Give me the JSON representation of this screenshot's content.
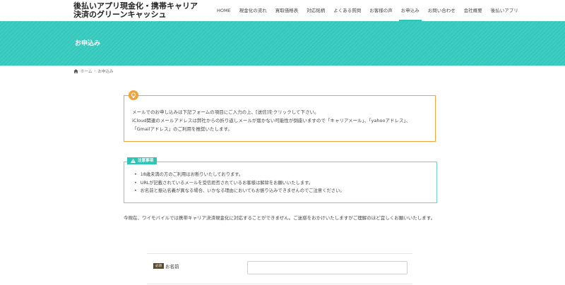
{
  "header": {
    "site_title_line1": "後払いアプリ現金化・携帯キャリア",
    "site_title_line2": "決済のグリーンキャッシュ",
    "nav": [
      {
        "label": "HOME"
      },
      {
        "label": "現金化の流れ"
      },
      {
        "label": "買取価格表"
      },
      {
        "label": "対応銘柄"
      },
      {
        "label": "よくある質問"
      },
      {
        "label": "お客様の声"
      },
      {
        "label": "お申込み",
        "active": true
      },
      {
        "label": "お問い合わせ"
      },
      {
        "label": "会社概要"
      },
      {
        "label": "後払いアプリ"
      }
    ]
  },
  "hero": {
    "title": "お申込み"
  },
  "breadcrumb": {
    "home": "ホーム",
    "separator": "›",
    "current": "お申込み"
  },
  "info": {
    "line1": "メールでのお申し込みは下記フォームの項目にご入力の上、[送信]をクリックして下さい。",
    "line2": "iCloud関連のメールアドレスは弊社からの折り返しメールが届かない可能性が倒座いますので「キャリアメール」、「yahooアドレス」、",
    "line3": "「Gmailアドレス」のご利用を推奨いたします。"
  },
  "notice": {
    "label": "注意事項",
    "items": [
      "18歳未満の方のご利用はお断りいたしております。",
      "URLが記載されているメールを受信拒否されているお客様は解除をお願いいたします。",
      "お名前と振込名義が異なる場合、いかなる理由においてもお振り込みできませんのでご注意ください。"
    ]
  },
  "body_text": "今現在、ワイモバイルでは携帯キャリア決済現金化に対応することができません。ご迷惑をおかけいたしますがご理解のほど宜しくお願いいたします。",
  "form": {
    "required_badge": "必須",
    "name_label": "お名前",
    "name_value": "",
    "name_placeholder": ""
  },
  "colors": {
    "accent": "#2ec4b6",
    "warning": "#f0a33a"
  }
}
